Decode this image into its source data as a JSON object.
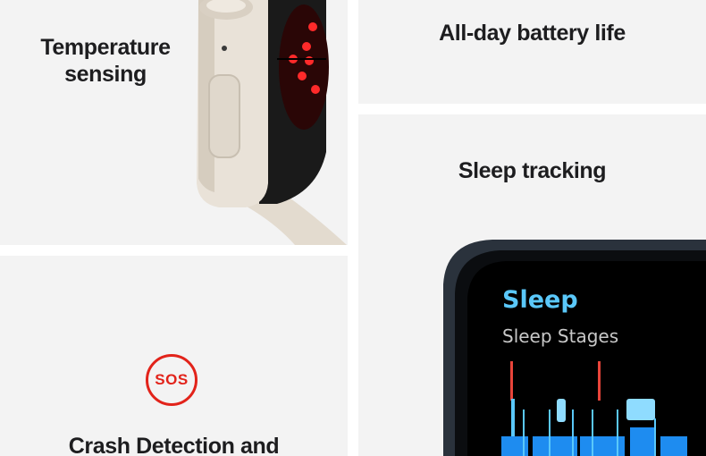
{
  "tiles": {
    "temperature": {
      "caption_line1": "Temperature",
      "caption_line2": "sensing"
    },
    "battery": {
      "caption": "All-day battery life"
    },
    "sleep": {
      "caption": "Sleep tracking",
      "screen_title": "Sleep",
      "screen_subtitle": "Sleep Stages"
    },
    "crash": {
      "badge": "SOS",
      "caption": "Crash Detection and"
    }
  },
  "colors": {
    "tile_background": "#f3f3f3",
    "text": "#1d1d1f",
    "sos_red": "#e2231a",
    "sleep_blue": "#5ac8fa",
    "chart_blue": "#1e8cf0",
    "sensor_red": "#ff2a2a",
    "watch_starlight": "#e9e2d8",
    "watch_midnight": "#1c2128"
  },
  "icons": [
    "sos-icon",
    "digital-crown-icon",
    "heart-sensor-icon"
  ]
}
